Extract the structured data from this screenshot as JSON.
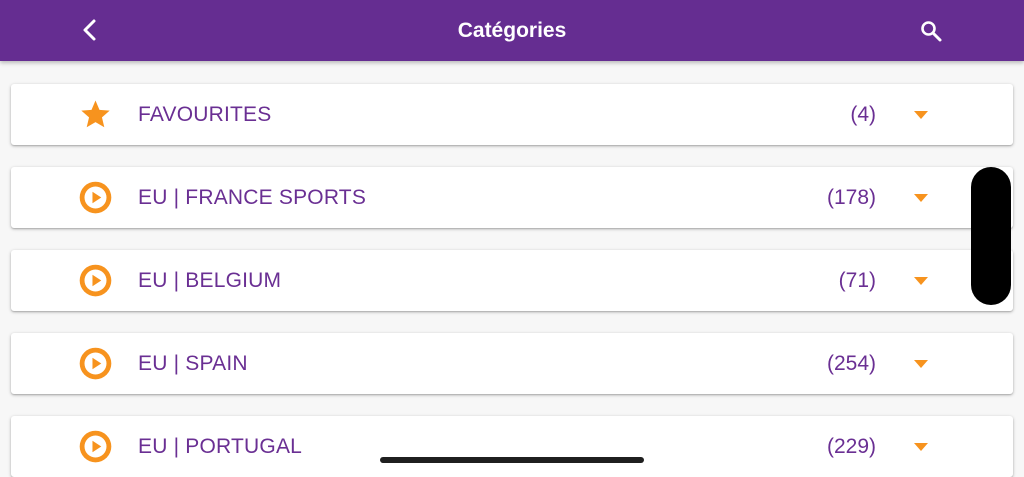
{
  "header": {
    "title": "Catégories",
    "back_icon": "chevron-left-icon",
    "search_icon": "search-icon",
    "background": "#652d91"
  },
  "categories": [
    {
      "name": "FAVOURITES",
      "count": "(4)",
      "icon": "star-icon"
    },
    {
      "name": "EU | FRANCE SPORTS",
      "count": "(178)",
      "icon": "play-circle-icon"
    },
    {
      "name": "EU | BELGIUM",
      "count": "(71)",
      "icon": "play-circle-icon"
    },
    {
      "name": "EU | SPAIN",
      "count": "(254)",
      "icon": "play-circle-icon"
    },
    {
      "name": "EU | PORTUGAL",
      "count": "(229)",
      "icon": "play-circle-icon"
    }
  ],
  "colors": {
    "accent": "#f7931e",
    "text": "#6a2f93"
  }
}
